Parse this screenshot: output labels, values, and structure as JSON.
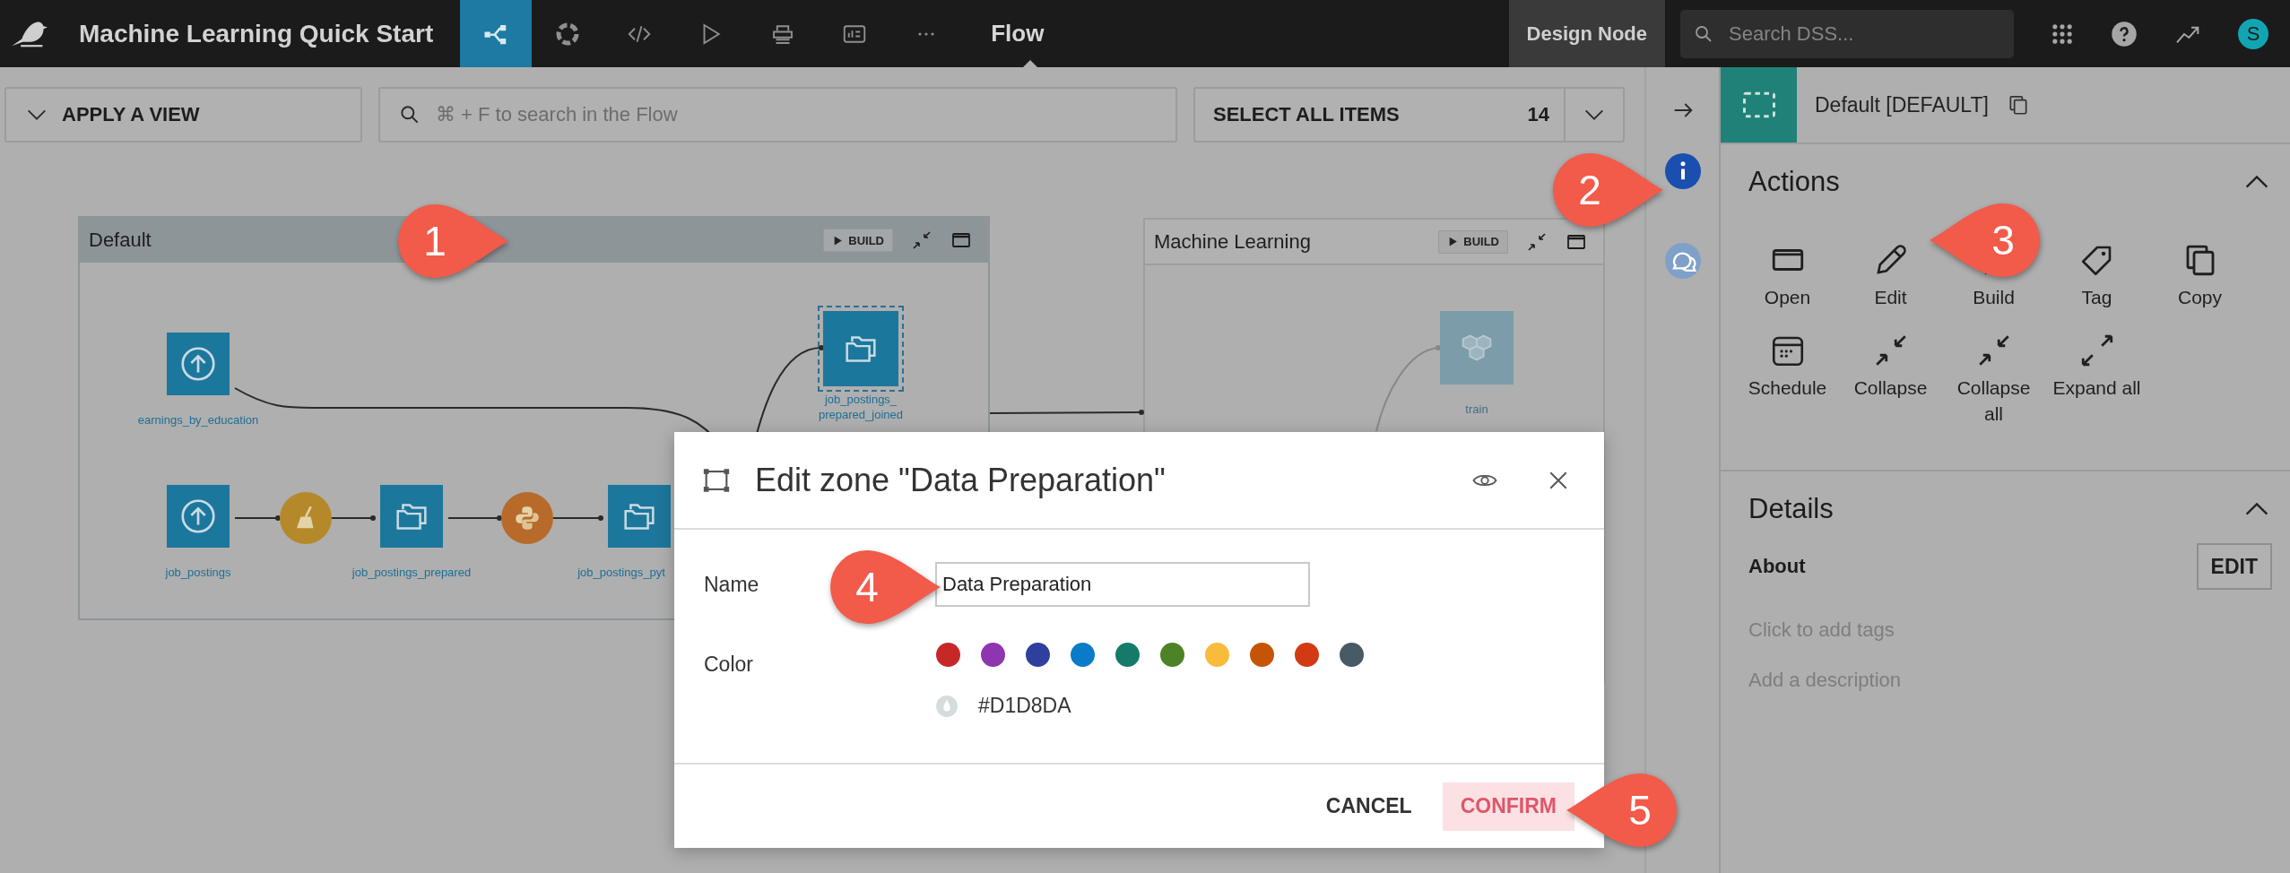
{
  "topbar": {
    "app_title": "Machine Learning Quick Start",
    "nav": [
      {
        "selected": true
      },
      {
        "selected": false
      },
      {
        "selected": false
      },
      {
        "selected": false
      },
      {
        "selected": false
      },
      {
        "selected": false
      },
      {
        "selected": false
      }
    ],
    "section": "Flow",
    "node_label": "Design Node",
    "search": {
      "placeholder": "Search DSS..."
    },
    "avatar": "S"
  },
  "toolbar": {
    "view_button": "APPLY A VIEW",
    "search": {
      "placeholder": "⌘ + F to search in the Flow"
    },
    "select_all": {
      "label": "SELECT ALL ITEMS",
      "count": "14"
    }
  },
  "zones": [
    {
      "title": "Default",
      "build": "BUILD",
      "selected": true,
      "nodes": [
        {
          "kind": "dataset",
          "label": "earnings_by_education",
          "selected": false
        },
        {
          "kind": "dataset",
          "label": "job_postings",
          "selected": false
        },
        {
          "kind": "recipe",
          "selected": false
        },
        {
          "kind": "dataset",
          "label": "job_postings_prepared",
          "selected": false
        },
        {
          "kind": "recipe",
          "selected": false
        },
        {
          "kind": "dataset",
          "label": "job_postings_pyt",
          "selected": false
        },
        {
          "kind": "dataset",
          "label": "job_postings_prepared_joined",
          "selected": true
        }
      ]
    },
    {
      "title": "Machine Learning",
      "build": "BUILD",
      "selected": false,
      "nodes": [
        {
          "kind": "model",
          "label": "train",
          "selected": false
        }
      ]
    }
  ],
  "side_strip": [
    {
      "selected": false
    },
    {
      "selected": true
    },
    {
      "selected": false
    }
  ],
  "panel": {
    "zone_label": "Default [DEFAULT]",
    "actions": {
      "title": "Actions",
      "expanded": true,
      "items": [
        {
          "label": "Open"
        },
        {
          "label": "Edit"
        },
        {
          "label": "Build"
        },
        {
          "label": "Tag"
        },
        {
          "label": "Copy"
        },
        {
          "label": "Schedule"
        },
        {
          "label": "Collapse"
        },
        {
          "label": "Collapse all"
        },
        {
          "label": "Expand all"
        }
      ]
    },
    "details": {
      "title": "Details",
      "expanded": true,
      "about": "About",
      "edit_button": "EDIT",
      "tags_placeholder": "Click to add tags",
      "description_placeholder": "Add a description"
    }
  },
  "dialog": {
    "title": "Edit zone \"Data Preparation\"",
    "name_label": "Name",
    "name_value": "Data Preparation",
    "color_label": "Color",
    "swatches": [
      {
        "color": "#c62828"
      },
      {
        "color": "#8e35b0"
      },
      {
        "color": "#2f3f9e"
      },
      {
        "color": "#0a7bc8"
      },
      {
        "color": "#147a6a"
      },
      {
        "color": "#4e8226"
      },
      {
        "color": "#f8bc3a"
      },
      {
        "color": "#c65406"
      },
      {
        "color": "#d23a14"
      },
      {
        "color": "#475a66"
      }
    ],
    "custom_color": "#D1D8DA",
    "cancel": "CANCEL",
    "confirm": "CONFIRM"
  },
  "callouts": [
    {
      "number": "1"
    },
    {
      "number": "2"
    },
    {
      "number": "3"
    },
    {
      "number": "4"
    },
    {
      "number": "5"
    }
  ]
}
